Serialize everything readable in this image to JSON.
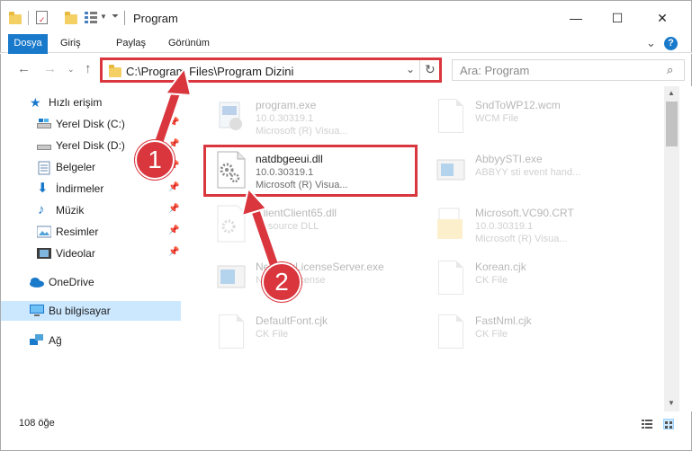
{
  "window": {
    "title": "Program",
    "minimize": "—",
    "maximize": "☐",
    "close": "✕"
  },
  "ribbon": {
    "tabs": [
      "Dosya",
      "Giriş",
      "Paylaş",
      "Görünüm"
    ],
    "help": "?",
    "collapse": "⌄"
  },
  "address": {
    "path": "C:\\Program Files\\Program Dizini",
    "search_placeholder": "Ara: Program"
  },
  "sidebar": {
    "quick_access": "Hızlı erişim",
    "items": [
      {
        "label": "Yerel Disk (C:)",
        "icon": "drive-icon"
      },
      {
        "label": "Yerel Disk (D:)",
        "icon": "drive-icon"
      },
      {
        "label": "Belgeler",
        "icon": "documents-icon"
      },
      {
        "label": "İndirmeler",
        "icon": "download-icon"
      },
      {
        "label": "Müzik",
        "icon": "music-icon"
      },
      {
        "label": "Resimler",
        "icon": "pictures-icon"
      },
      {
        "label": "Videolar",
        "icon": "videos-icon"
      }
    ],
    "onedrive": "OneDrive",
    "this_pc": "Bu bilgisayar",
    "network": "Ağ"
  },
  "files": [
    {
      "name": "program.exe",
      "l2": "10.0.30319.1",
      "l3": "Microsoft (R) Visua..."
    },
    {
      "name": "SndToWP12.wcm",
      "l2": "WCM File",
      "l3": ""
    },
    {
      "name": "natdbgeeui.dll",
      "l2": "10.0.30319.1",
      "l3": "Microsoft (R) Visua..."
    },
    {
      "name": "AbbyySTI.exe",
      "l2": "ABBYY sti event hand...",
      "l3": ""
    },
    {
      "name": "ClientClient65.dll",
      "l2": "Resource DLL",
      "l3": ""
    },
    {
      "name": "Microsoft.VC90.CRT",
      "l2": "10.0.30319.1",
      "l3": "Microsoft (R) Visua..."
    },
    {
      "name": "NetworkLicenseServer.exe",
      "l2": "Network license",
      "l3": ""
    },
    {
      "name": "Korean.cjk",
      "l2": "CK File",
      "l3": ""
    },
    {
      "name": "DefaultFont.cjk",
      "l2": "CK File",
      "l3": ""
    },
    {
      "name": "FastNml.cjk",
      "l2": "CK File",
      "l3": ""
    }
  ],
  "status": {
    "count": "108 öğe"
  },
  "callouts": [
    "1",
    "2"
  ],
  "colors": {
    "accent": "#1979ca",
    "highlight": "#d9363e",
    "selected": "#cce8ff"
  }
}
